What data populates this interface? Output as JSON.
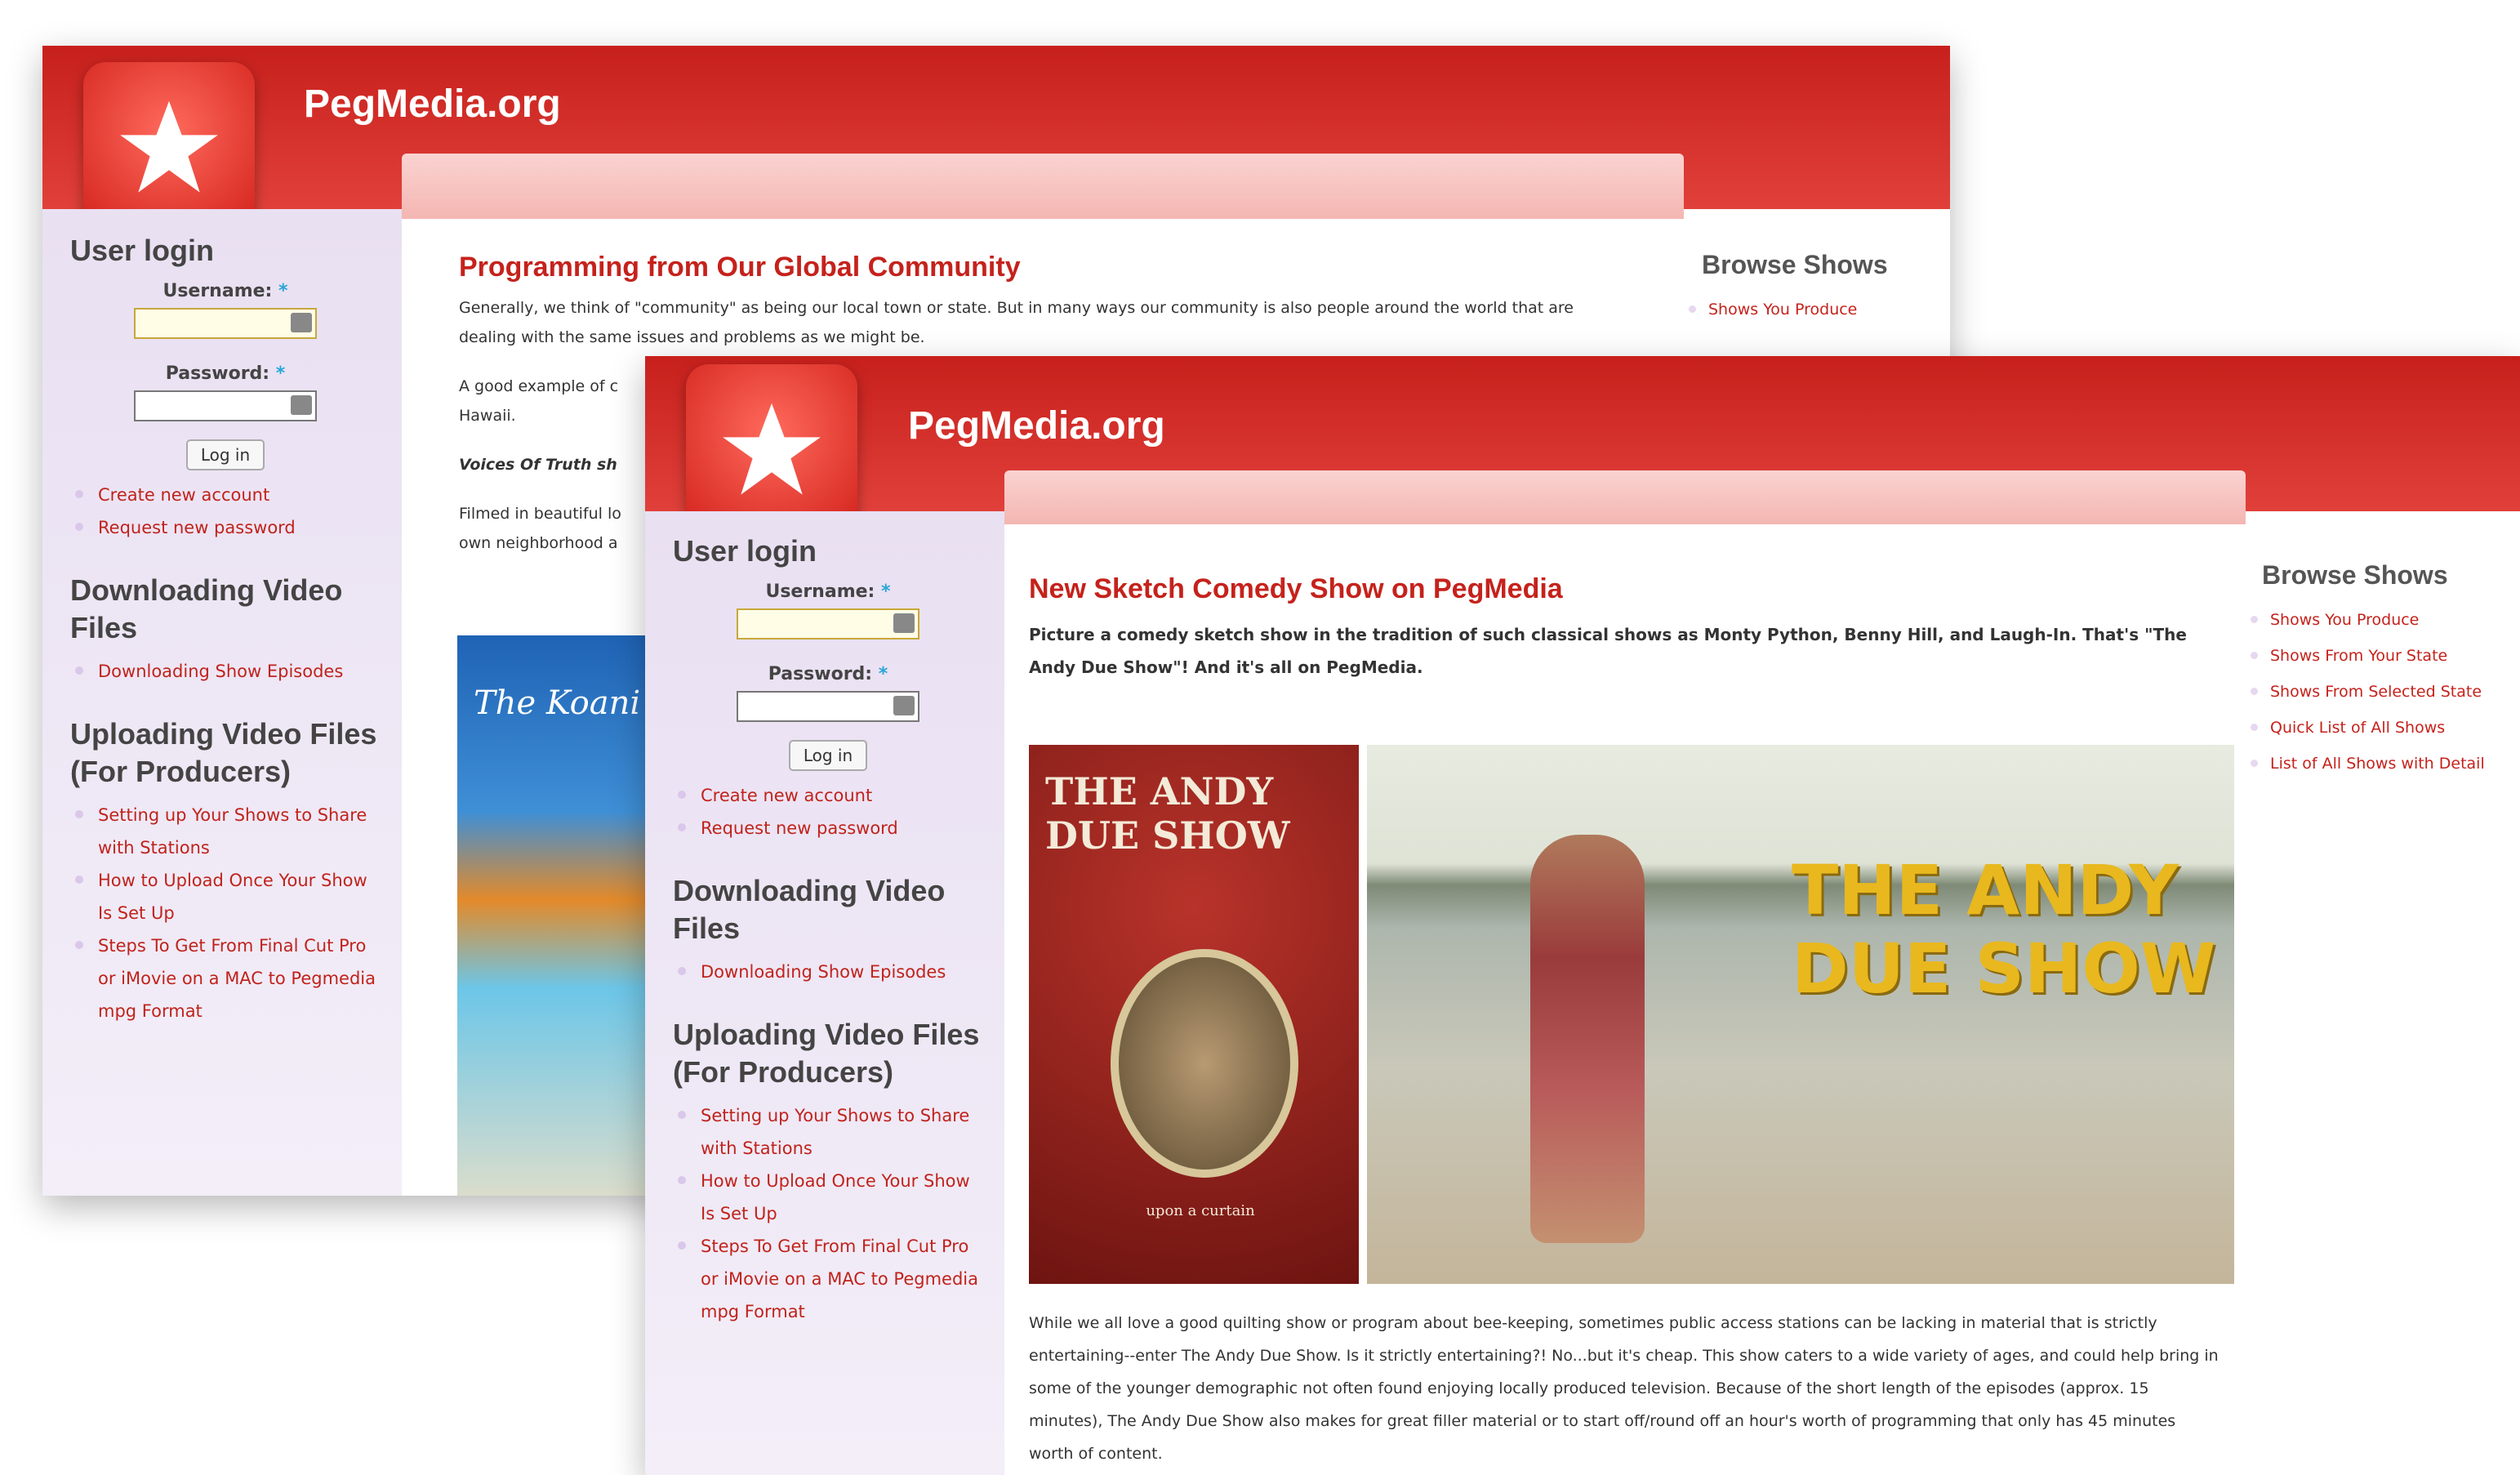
{
  "site": {
    "title": "PegMedia.org"
  },
  "back": {
    "login": {
      "heading": "User login",
      "username_label": "Username:",
      "password_label": "Password:",
      "required_mark": "*",
      "button": "Log in",
      "links": [
        "Create new account",
        "Request new password"
      ]
    },
    "downloading": {
      "heading": "Downloading Video Files",
      "links": [
        "Downloading Show Episodes"
      ]
    },
    "uploading": {
      "heading": "Uploading Video Files (For Producers)",
      "links": [
        "Setting up Your Shows to Share with Stations",
        "How to Upload Once Your Show Is Set Up",
        "Steps To Get From Final Cut Pro or iMovie on a MAC to Pegmedia mpg Format"
      ]
    },
    "article": {
      "title": "Programming from Our Global Community",
      "p1": "Generally, we think of \"community\" as being our local town or state. But in many ways our community is also people around the world that are dealing with the same issues and problems as we might be.",
      "p2_fragment": "A good example of c",
      "p2_line2": "Hawaii.",
      "p3_fragment": "Voices Of Truth sh",
      "p4_fragment": "Filmed in beautiful lo",
      "p4_line2": "own neighborhood a",
      "image_caption": "The Koani"
    },
    "browse": {
      "heading": "Browse Shows",
      "links": [
        "Shows You Produce"
      ]
    }
  },
  "front": {
    "login": {
      "heading": "User login",
      "username_label": "Username:",
      "password_label": "Password:",
      "required_mark": "*",
      "button": "Log in",
      "links": [
        "Create new account",
        "Request new password"
      ]
    },
    "downloading": {
      "heading": "Downloading Video Files",
      "links": [
        "Downloading Show Episodes"
      ]
    },
    "uploading": {
      "heading": "Uploading Video Files (For Producers)",
      "links": [
        "Setting up Your Shows to Share with Stations",
        "How to Upload Once Your Show Is Set Up",
        "Steps To Get From Final Cut Pro or iMovie on a MAC to Pegmedia mpg Format"
      ]
    },
    "article": {
      "title": "New Sketch Comedy Show on PegMedia",
      "lead": "Picture a comedy sketch show in the tradition of such classical shows as Monty Python, Benny Hill, and Laugh-In. That's \"The Andy Due Show\"! And it's all on PegMedia.",
      "poster_text": "THE ANDY DUE SHOW",
      "poster_sub": "upon a curtain",
      "video_text_1": "THE ANDY",
      "video_text_2": "DUE SHOW",
      "body": "While we all love a good quilting show or program about bee-keeping, sometimes public access stations can be lacking in material that is strictly entertaining--enter The Andy Due Show. Is it strictly entertaining?! No...but it's cheap. This show caters to a wide variety of ages, and could help bring in some of the younger demographic not often found enjoying locally produced television. Because of the short length of the episodes (approx. 15 minutes), The Andy Due Show also makes for great filler material or to start off/round off an hour's worth of programming that only has 45 minutes worth of content."
    },
    "browse": {
      "heading": "Browse Shows",
      "links": [
        "Shows You Produce",
        "Shows From Your State",
        "Shows From Selected State",
        "Quick List of All Shows",
        "List of All Shows with Detail"
      ]
    }
  },
  "colors": {
    "header_red": "#d12a24",
    "link_red": "#c0231c",
    "sidebar_lavender": "#ece3f4",
    "band_pink": "#f7c3c0"
  }
}
